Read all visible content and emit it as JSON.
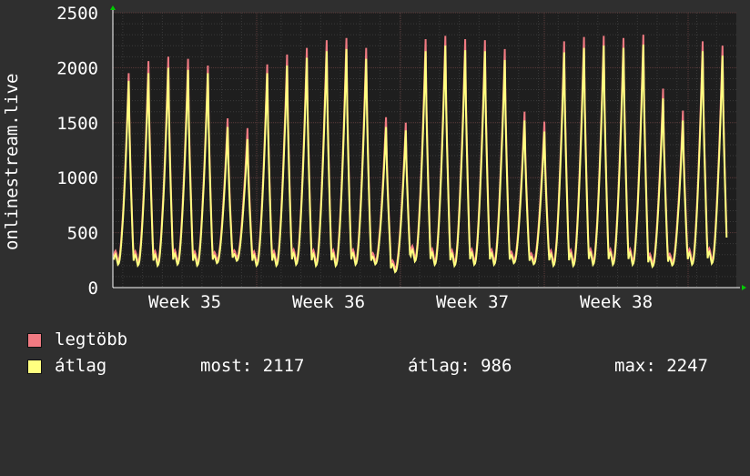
{
  "chart_data": {
    "type": "line",
    "ylabel": "onlinestream.live",
    "ylim": [
      0,
      2500
    ],
    "yticks": [
      0,
      500,
      1000,
      1500,
      2000,
      2500
    ],
    "xticks": [
      "Week 35",
      "Week 36",
      "Week 37",
      "Week 38"
    ],
    "grid": true,
    "colors": {
      "background": "#2f2f2f",
      "canvas": "#1e1e1e",
      "grid_major": "#5a3a3a",
      "grid_minor": "#3a3a3a",
      "max_line": "#f07a82",
      "avg_line": "#ffff80",
      "axis_arrow": "#00cc00"
    },
    "series": [
      {
        "name": "legtöbb",
        "daily_peaks": [
          1950,
          2060,
          2100,
          2080,
          2020,
          1540,
          1450,
          2030,
          2120,
          2180,
          2250,
          2270,
          2180,
          1550,
          1500,
          2260,
          2290,
          2260,
          2250,
          2170,
          1600,
          1510,
          2240,
          2280,
          2290,
          2270,
          2300,
          1810,
          1610,
          2240,
          2200
        ],
        "daily_troughs": [
          250,
          240,
          240,
          250,
          240,
          260,
          280,
          240,
          240,
          250,
          240,
          240,
          250,
          250,
          180,
          280,
          250,
          240,
          250,
          250,
          260,
          250,
          240,
          240,
          250,
          250,
          250,
          230,
          240,
          250,
          260
        ]
      },
      {
        "name": "átlag",
        "daily_peaks": [
          1880,
          1950,
          2000,
          1980,
          1950,
          1460,
          1350,
          1950,
          2020,
          2090,
          2150,
          2170,
          2080,
          1460,
          1430,
          2150,
          2200,
          2160,
          2150,
          2070,
          1520,
          1420,
          2140,
          2180,
          2200,
          2180,
          2210,
          1720,
          1520,
          2150,
          2110
        ],
        "daily_troughs": [
          220,
          210,
          210,
          220,
          210,
          230,
          250,
          210,
          210,
          220,
          210,
          210,
          220,
          220,
          150,
          250,
          220,
          210,
          220,
          220,
          230,
          220,
          210,
          210,
          220,
          220,
          220,
          200,
          210,
          220,
          230
        ]
      }
    ]
  },
  "legend": {
    "max_label": "legtöbb",
    "avg_label": "átlag",
    "current": "most: 2117",
    "average": "átlag: 986",
    "maximum": "max: 2247"
  }
}
